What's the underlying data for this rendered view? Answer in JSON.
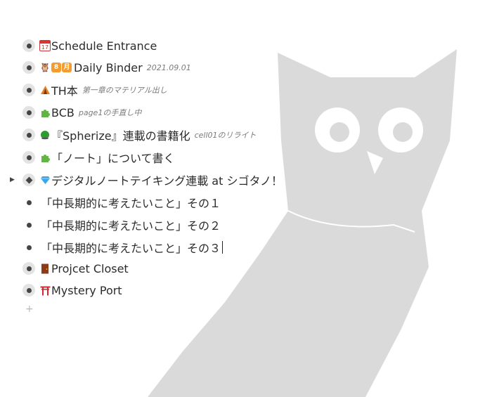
{
  "items": [
    {
      "icon": "calendar-icon",
      "title": "Schedule Entrance",
      "note": ""
    },
    {
      "icon": "owl-icon",
      "title": "Daily Binder",
      "note": "2021.09.01",
      "badges": [
        "8",
        "月"
      ]
    },
    {
      "icon": "tent-icon",
      "title": "TH本",
      "note": "第一章のマテリアル出し"
    },
    {
      "icon": "puzzle-icon",
      "title": "BCB",
      "note": "page1の手直し中"
    },
    {
      "icon": "green-ball-icon",
      "title": "『Spherize』連載の書籍化",
      "note": "cell01のリライト"
    },
    {
      "icon": "puzzle-icon",
      "title": "「ノート」について書く",
      "note": ""
    },
    {
      "icon": "gem-icon",
      "title": "デジタルノートテイキング連載 at シゴタノ！",
      "note": ""
    },
    {
      "icon": "",
      "title": "「中長期的に考えたいこと」その１",
      "note": ""
    },
    {
      "icon": "",
      "title": "「中長期的に考えたいこと」その２",
      "note": ""
    },
    {
      "icon": "",
      "title": "「中長期的に考えたいこと」その３",
      "note": ""
    },
    {
      "icon": "door-icon",
      "title": "Projcet Closet",
      "note": ""
    },
    {
      "icon": "torii-icon",
      "title": "Mystery Port",
      "note": ""
    }
  ],
  "add_label": "+",
  "calendar_day": "17",
  "colors": {
    "owl": "#d9d9d9",
    "bullet_ring": "#e3e3e3",
    "note": "#7a7a7a"
  }
}
